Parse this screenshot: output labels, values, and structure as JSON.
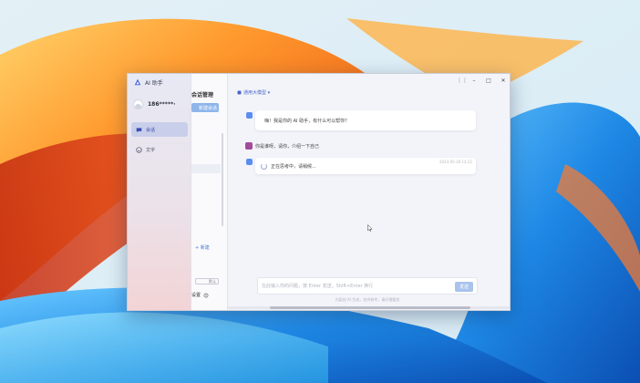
{
  "app": {
    "title": "AI 助手"
  },
  "user": {
    "phone": "186*****·"
  },
  "nav": {
    "items": [
      {
        "label": "会话",
        "icon": "chat-bubble-icon",
        "active": true
      },
      {
        "label": "文字",
        "icon": "document-icon",
        "active": false
      }
    ]
  },
  "mid": {
    "heading": "会话管理",
    "new_button": "新建会话",
    "add_link": "+ 新建",
    "tag": "默认",
    "footer_label": "设置",
    "footer_icon": "settings-icon"
  },
  "header": {
    "model_label": "通用大模型 ▾",
    "controls": [
      "⋮⋮",
      "–",
      "□",
      "✕"
    ]
  },
  "messages": [
    {
      "role": "assistant",
      "text": "嗨！我是你的 AI 助手，有什么可以帮你？"
    },
    {
      "role": "user",
      "text": "你是谁呀，请你，介绍一下自己"
    },
    {
      "role": "assistant",
      "text": "正在思考中，请稍候...",
      "time": "2024-05-28 14:22"
    }
  ],
  "composer": {
    "placeholder": "在此输入你的问题，按 Enter 发送，Shift+Enter 换行",
    "value": "",
    "send_label": "发送",
    "disclaimer": "内容由 AI 生成，仅供参考，请仔细甄别"
  },
  "colors": {
    "accent": "#5b8def",
    "nav_active": "#c9cfea",
    "send": "#a9c3ec"
  }
}
